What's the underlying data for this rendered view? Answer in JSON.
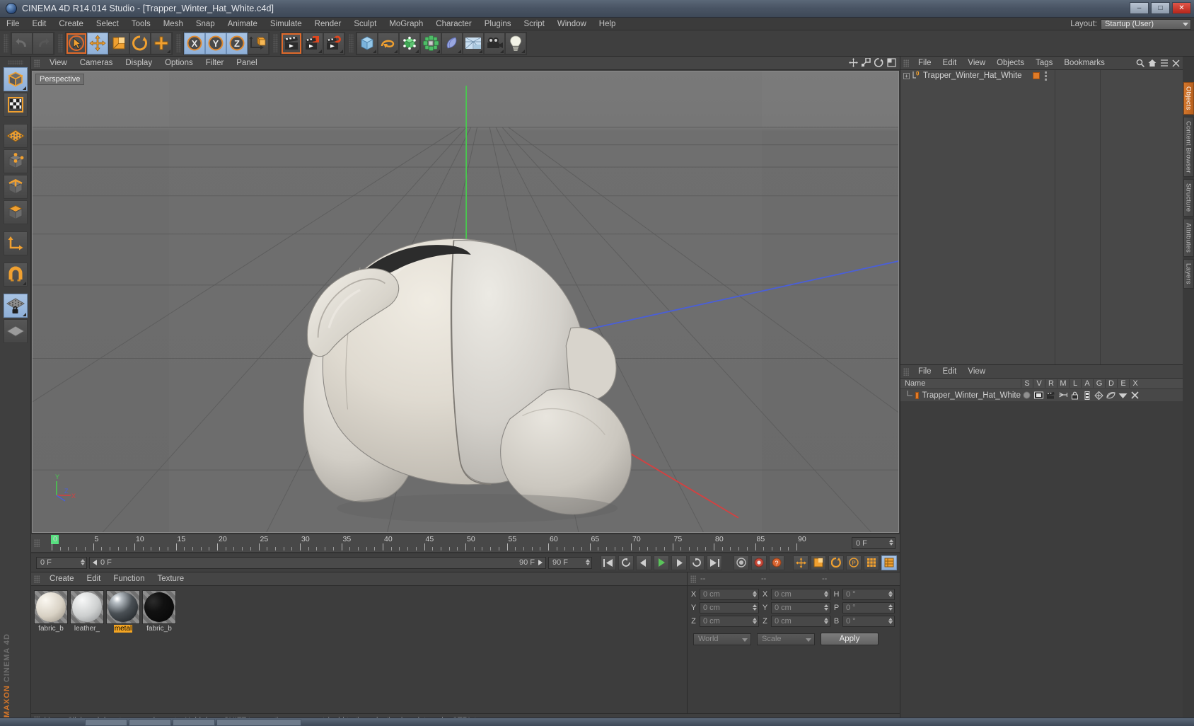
{
  "window": {
    "title": "CINEMA 4D R14.014 Studio - [Trapper_Winter_Hat_White.c4d]",
    "app_icon": "c4d-logo-icon",
    "controls": {
      "minimize": "–",
      "maximize": "□",
      "close": "✕"
    }
  },
  "menubar": {
    "items": [
      "File",
      "Edit",
      "Create",
      "Select",
      "Tools",
      "Mesh",
      "Snap",
      "Animate",
      "Simulate",
      "Render",
      "Sculpt",
      "MoGraph",
      "Character",
      "Plugins",
      "Script",
      "Window",
      "Help"
    ],
    "layout_label": "Layout:",
    "layout_value": "Startup (User)"
  },
  "toolbar": {
    "groups": [
      {
        "name": "history",
        "buttons": [
          {
            "name": "undo-button",
            "icon": "undo-arrow-icon",
            "state": "disabled"
          },
          {
            "name": "redo-button",
            "icon": "redo-arrow-icon",
            "state": "disabled"
          }
        ]
      },
      {
        "name": "transform-tools",
        "buttons": [
          {
            "name": "select-tool",
            "icon": "cursor-circle-icon",
            "state": "highlight"
          },
          {
            "name": "move-tool",
            "icon": "move-cross-icon",
            "state": "active"
          },
          {
            "name": "scale-tool",
            "icon": "scale-box-icon",
            "state": "normal"
          },
          {
            "name": "rotate-tool",
            "icon": "rotate-arc-icon",
            "state": "normal"
          },
          {
            "name": "add-tool",
            "icon": "plus-cross-icon",
            "state": "normal"
          }
        ]
      },
      {
        "name": "axis-locks",
        "buttons": [
          {
            "name": "lock-x-axis",
            "icon": "x-axis-icon",
            "state": "active"
          },
          {
            "name": "lock-y-axis",
            "icon": "y-axis-icon",
            "state": "active"
          },
          {
            "name": "lock-z-axis",
            "icon": "z-axis-icon",
            "state": "active"
          },
          {
            "name": "world-object-axis",
            "icon": "world-coordinate-icon",
            "state": "normal"
          }
        ]
      },
      {
        "name": "render-tools",
        "buttons": [
          {
            "name": "render-view",
            "icon": "clapboard-icon",
            "state": "highlight"
          },
          {
            "name": "render-region",
            "icon": "clapboard-region-icon",
            "state": "normal"
          },
          {
            "name": "render-settings",
            "icon": "clapboard-gear-icon",
            "state": "normal"
          }
        ]
      },
      {
        "name": "create-objects",
        "buttons": [
          {
            "name": "add-cube-object",
            "icon": "cube-icon",
            "state": "normal"
          },
          {
            "name": "add-spline",
            "icon": "spline-icon",
            "state": "normal"
          },
          {
            "name": "add-generator",
            "icon": "green-cube-icon",
            "state": "normal"
          },
          {
            "name": "add-mograph",
            "icon": "cloner-icon",
            "state": "normal"
          },
          {
            "name": "add-deformer",
            "icon": "bend-deformer-icon",
            "state": "normal"
          },
          {
            "name": "add-environment",
            "icon": "floor-environment-icon",
            "state": "normal"
          },
          {
            "name": "add-camera",
            "icon": "camera-icon",
            "state": "normal"
          },
          {
            "name": "add-light",
            "icon": "light-bulb-icon",
            "state": "normal"
          }
        ]
      }
    ]
  },
  "left_toolbar": {
    "buttons": [
      {
        "name": "model-mode",
        "icon": "cube-model-icon",
        "state": "active"
      },
      {
        "name": "texture-mode",
        "icon": "checker-texture-icon",
        "state": "highlight"
      },
      {
        "name": "points-mode-group",
        "icon": "orange-grid-icon",
        "state": "normal"
      },
      {
        "name": "point-mode",
        "icon": "point-vertex-icon",
        "state": "normal"
      },
      {
        "name": "edge-mode",
        "icon": "edge-cube-icon",
        "state": "normal"
      },
      {
        "name": "polygon-mode",
        "icon": "polygon-cube-icon",
        "state": "normal"
      },
      {
        "name": "axis-mode",
        "icon": "axis-arrows-icon",
        "state": "normal"
      },
      {
        "name": "enable-snap",
        "icon": "magnet-icon",
        "state": "normal"
      },
      {
        "name": "workplane-lock",
        "icon": "workplane-lock-icon",
        "state": "active"
      },
      {
        "name": "workplane-tool",
        "icon": "workplane-icon",
        "state": "normal"
      }
    ],
    "brand_line1": "MAXON",
    "brand_line2": "CINEMA 4D"
  },
  "viewport": {
    "menu": [
      "View",
      "Cameras",
      "Display",
      "Options",
      "Filter",
      "Panel"
    ],
    "label": "Perspective",
    "axis_labels": {
      "x": "X",
      "y": "Y",
      "z": "Z"
    },
    "corner_icons": [
      "move-view-icon",
      "scale-view-icon",
      "rotate-view-icon",
      "maximize-view-icon"
    ],
    "object_description": "white trapper winter hat 3d model"
  },
  "timeline": {
    "ticks": [
      0,
      5,
      10,
      15,
      20,
      25,
      30,
      35,
      40,
      45,
      50,
      55,
      60,
      65,
      70,
      75,
      80,
      85,
      90
    ],
    "playhead_frame": 0,
    "end_frame_field": "0 F",
    "current_frame_field": "0 F",
    "range_start_label": "0 F",
    "range_end_label": "90 F",
    "preview_end_field": "90 F",
    "transport": [
      {
        "name": "go-to-start-button",
        "icon": "skip-start-icon"
      },
      {
        "name": "play-backwards-loop-button",
        "icon": "loop-back-icon"
      },
      {
        "name": "step-back-button",
        "icon": "prev-frame-icon"
      },
      {
        "name": "play-button",
        "icon": "play-icon"
      },
      {
        "name": "step-forward-button",
        "icon": "next-frame-icon"
      },
      {
        "name": "play-forward-loop-button",
        "icon": "loop-forward-icon"
      },
      {
        "name": "go-to-end-button",
        "icon": "skip-end-icon"
      }
    ],
    "keyframe_tools": [
      {
        "name": "record-active-objects",
        "icon": "record-circle-icon"
      },
      {
        "name": "autokeying-toggle",
        "icon": "autokey-icon"
      },
      {
        "name": "keyframe-selection",
        "icon": "question-key-icon"
      },
      {
        "name": "position-key-toggle",
        "icon": "position-key-icon"
      },
      {
        "name": "scale-key-toggle",
        "icon": "scale-key-icon"
      },
      {
        "name": "rotation-key-toggle",
        "icon": "rotation-key-icon"
      },
      {
        "name": "pla-key-toggle",
        "icon": "pla-key-icon"
      },
      {
        "name": "param-key-toggle",
        "icon": "param-key-icon"
      },
      {
        "name": "dope-sheet-toggle",
        "icon": "dopesheet-icon"
      }
    ]
  },
  "material_manager": {
    "menu": [
      "Create",
      "Edit",
      "Function",
      "Texture"
    ],
    "materials": [
      {
        "name": "fabric_b",
        "label": "fabric_b",
        "color": "#cdc6ba",
        "selected": false
      },
      {
        "name": "leather",
        "label": "leather_",
        "color": "#c9cbcb",
        "selected": false
      },
      {
        "name": "metal",
        "label": "metal",
        "color": "#3d4145",
        "selected": true
      },
      {
        "name": "fabric_b2",
        "label": "fabric_b",
        "color": "#0c0c0c",
        "selected": false
      }
    ]
  },
  "coordinates": {
    "headers": [
      "--",
      "--",
      "--"
    ],
    "rows": [
      {
        "label1": "X",
        "value1": "0 cm",
        "label2": "X",
        "value2": "0 cm",
        "label3": "H",
        "value3": "0 °"
      },
      {
        "label1": "Y",
        "value1": "0 cm",
        "label2": "Y",
        "value2": "0 cm",
        "label3": "P",
        "value3": "0 °"
      },
      {
        "label1": "Z",
        "value1": "0 cm",
        "label2": "Z",
        "value2": "0 cm",
        "label3": "B",
        "value3": "0 °"
      }
    ],
    "coord_system": "World",
    "size_mode": "Scale",
    "apply_label": "Apply"
  },
  "status_bar": {
    "message": "Move: Click and drag to move elements. Hold down SHIFT to quantize movement / add to the selection in point mode, CTRL to remove."
  },
  "object_manager": {
    "menu": [
      "File",
      "Edit",
      "View",
      "Objects",
      "Tags",
      "Bookmarks"
    ],
    "header_icons": [
      "search-icon",
      "home-icon",
      "collapse-icon",
      "close-icon"
    ],
    "objects": [
      {
        "name": "Trapper_Winter_Hat_White",
        "level": 0,
        "tag_color": "#e07b27"
      }
    ]
  },
  "layer_manager": {
    "menu": [
      "File",
      "Edit",
      "View"
    ],
    "columns": [
      "Name",
      "S",
      "V",
      "R",
      "M",
      "L",
      "A",
      "G",
      "D",
      "E",
      "X"
    ],
    "rows": [
      {
        "name": "Trapper_Winter_Hat_White",
        "solo": "solo-dot-icon",
        "visible": "view-icon",
        "render": "render-icon",
        "manager": "manager-icon",
        "locked": "lock-icon",
        "animation": "animation-icon",
        "generators": "generator-icon",
        "deformers": "deformer-icon",
        "expressions": "expression-icon",
        "xref": "xref-icon"
      }
    ]
  },
  "right_tabs": [
    {
      "label": "Objects",
      "active": true
    },
    {
      "label": "Content Browser",
      "active": false
    },
    {
      "label": "Structure",
      "active": false
    },
    {
      "label": "Attributes",
      "active": false
    },
    {
      "label": "Layers",
      "active": false
    }
  ]
}
